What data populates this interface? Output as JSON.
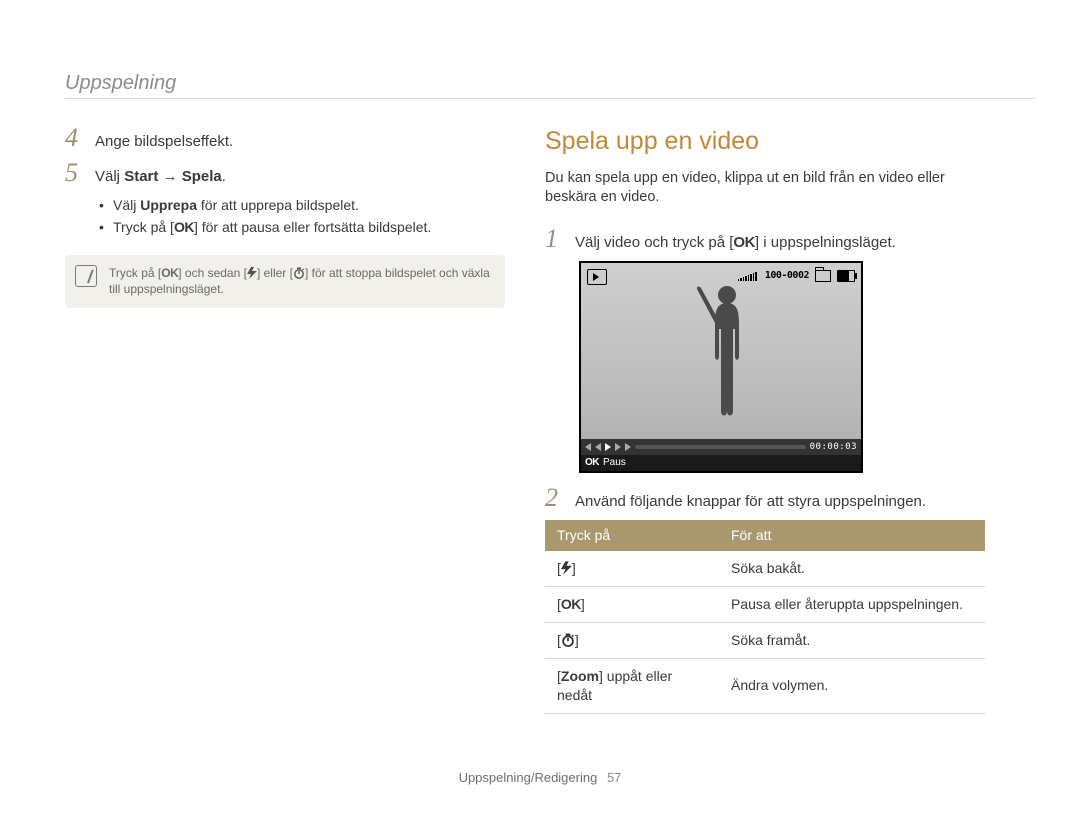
{
  "header": {
    "title": "Uppspelning"
  },
  "left": {
    "steps": [
      {
        "num": "4",
        "text": "Ange bildspelseffekt."
      },
      {
        "num": "5",
        "pre": "Välj ",
        "b1": "Start",
        "arrow": " → ",
        "b2": "Spela",
        "post": "."
      }
    ],
    "bullets": [
      {
        "pre": "Välj ",
        "bold": "Upprepa",
        "post": " för att upprepa bildspelet."
      },
      {
        "pre": "Tryck på [",
        "ok": "OK",
        "post": "] för att pausa eller fortsätta bildspelet."
      }
    ],
    "note": {
      "pre": "Tryck på [",
      "ok": "OK",
      "mid1": "] och sedan [",
      "mid2": "] eller [",
      "post": "] för att stoppa bildspelet och växla till uppspelningsläget."
    }
  },
  "right": {
    "title": "Spela upp en video",
    "intro": "Du kan spela upp en video, klippa ut en bild från en video eller beskära en video.",
    "step1": {
      "num": "1",
      "pre": "Välj video och tryck på [",
      "ok": "OK",
      "post": "] i uppspelningsläget."
    },
    "step2": {
      "num": "2",
      "text": "Använd följande knappar för att styra uppspelningen."
    },
    "preview": {
      "counter": "100-0002",
      "time": "00:00:03",
      "status_ok": "OK",
      "status_label": "Paus"
    },
    "table": {
      "head": {
        "left": "Tryck på",
        "right": "För att"
      },
      "rows": [
        {
          "key_type": "flash",
          "value": "Söka bakåt."
        },
        {
          "key_type": "ok",
          "value": "Pausa eller återuppta uppspelningen."
        },
        {
          "key_type": "timer",
          "value": "Söka framåt."
        },
        {
          "key_type": "zoom",
          "key_pre": "[",
          "key_bold": "Zoom",
          "key_post": "] uppåt eller nedåt",
          "value": "Ändra volymen."
        }
      ]
    }
  },
  "footer": {
    "section": "Uppspelning/Redigering",
    "page": "57"
  }
}
